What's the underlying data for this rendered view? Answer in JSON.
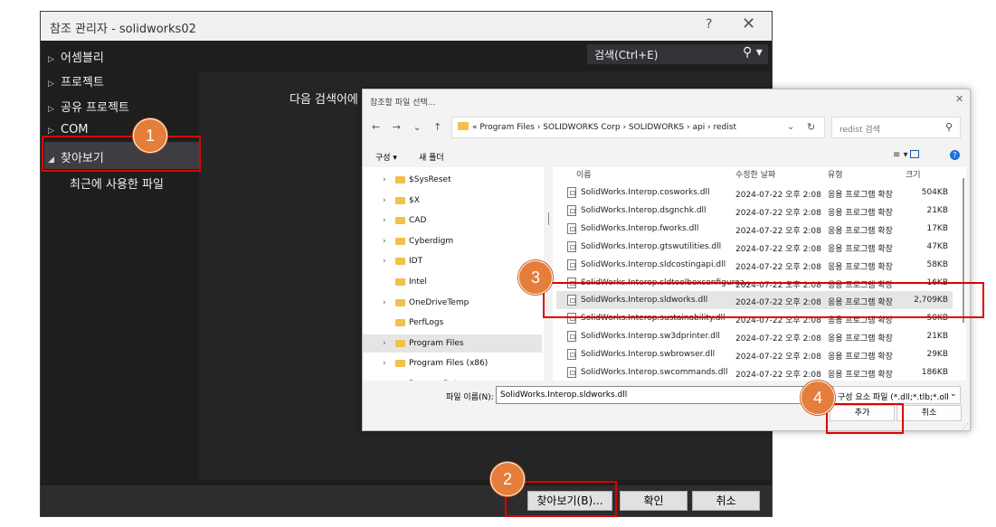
{
  "ref_manager": {
    "title": "참조 관리자 - solidworks02",
    "help_label": "?",
    "close_label": "✕",
    "tree": [
      {
        "label": "어셈블리",
        "arrow": "▷"
      },
      {
        "label": "프로젝트",
        "arrow": "▷"
      },
      {
        "label": "공유 프로젝트",
        "arrow": "▷"
      },
      {
        "label": "COM",
        "arrow": "▷"
      },
      {
        "label": "찾아보기",
        "arrow": "◢"
      }
    ],
    "recent_files": "최근에 사용한 파일",
    "search_placeholder": "검색(Ctrl+E)",
    "search_icon": "⚲ ▾",
    "hint_text": "다음 검색어에 대한",
    "buttons": {
      "browse": "찾아보기(B)...",
      "ok": "확인",
      "cancel": "취소"
    }
  },
  "file_dialog": {
    "title": "참조할 파일 선택...",
    "close_label": "✕",
    "nav": {
      "back": "←",
      "forward": "→",
      "recent": "⌄",
      "up": "↑"
    },
    "address": "« Program Files › SOLIDWORKS Corp › SOLIDWORKS › api › redist",
    "address_chevron": "⌄",
    "refresh_icon": "↻",
    "search_placeholder": "redist 검색",
    "search_icon": "⚲",
    "organize": "구성 ▾",
    "new_folder": "새 폴더",
    "view_icon": "≡ ▾",
    "help_icon": "?",
    "left_tree": [
      {
        "label": "$SysReset",
        "expand": true
      },
      {
        "label": "$X",
        "expand": true
      },
      {
        "label": "CAD",
        "expand": true
      },
      {
        "label": "Cyberdigm",
        "expand": true
      },
      {
        "label": "IDT",
        "expand": true
      },
      {
        "label": "Intel",
        "expand": false
      },
      {
        "label": "OneDriveTemp",
        "expand": true
      },
      {
        "label": "PerfLogs",
        "expand": false
      },
      {
        "label": "Program Files",
        "expand": true,
        "selected": true
      },
      {
        "label": "Program Files (x86)",
        "expand": true
      },
      {
        "label": "ProgramData",
        "expand": true
      }
    ],
    "columns": {
      "name": "이름",
      "date": "수정한 날짜",
      "type": "유형",
      "size": "크기",
      "sort_caret": "^"
    },
    "files": [
      {
        "name": "SolidWorks.Interop.cosworks.dll",
        "date": "2024-07-22 오후 2:08",
        "type": "응용 프로그램 확장",
        "size": "504KB"
      },
      {
        "name": "SolidWorks.Interop.dsgnchk.dll",
        "date": "2024-07-22 오후 2:08",
        "type": "응용 프로그램 확장",
        "size": "21KB"
      },
      {
        "name": "SolidWorks.Interop.fworks.dll",
        "date": "2024-07-22 오후 2:08",
        "type": "응용 프로그램 확장",
        "size": "17KB"
      },
      {
        "name": "SolidWorks.Interop.gtswutilities.dll",
        "date": "2024-07-22 오후 2:08",
        "type": "응용 프로그램 확장",
        "size": "47KB"
      },
      {
        "name": "SolidWorks.Interop.sldcostingapi.dll",
        "date": "2024-07-22 오후 2:08",
        "type": "응용 프로그램 확장",
        "size": "58KB"
      },
      {
        "name": "SolidWorks.Interop.sldtoolboxconfigurea...",
        "date": "2024-07-22 오후 2:08",
        "type": "응용 프로그램 확장",
        "size": "16KB"
      },
      {
        "name": "SolidWorks.Interop.sldworks.dll",
        "date": "2024-07-22 오후 2:08",
        "type": "응용 프로그램 확장",
        "size": "2,709KB",
        "selected": true
      },
      {
        "name": "SolidWorks.Interop.sustainability.dll",
        "date": "2024-07-22 오후 2:08",
        "type": "응용 프로그램 확장",
        "size": "50KB"
      },
      {
        "name": "SolidWorks.Interop.sw3dprinter.dll",
        "date": "2024-07-22 오후 2:08",
        "type": "응용 프로그램 확장",
        "size": "21KB"
      },
      {
        "name": "SolidWorks.Interop.swbrowser.dll",
        "date": "2024-07-22 오후 2:08",
        "type": "응용 프로그램 확장",
        "size": "29KB"
      },
      {
        "name": "SolidWorks.Interop.swcommands.dll",
        "date": "2024-07-22 오후 2:08",
        "type": "응용 프로그램 확장",
        "size": "186KB"
      }
    ],
    "filename_label": "파일 이름(N):",
    "filename_value": "SolidWorks.Interop.sldworks.dll",
    "filter_value": "구성 요소 파일 (*.dll;*.tlb;*.olb;",
    "filter_chevron": "⌄",
    "add_button": "추가",
    "cancel_button": "취소",
    "grip": "⋰"
  },
  "callouts": [
    "1",
    "2",
    "3",
    "4"
  ],
  "colors": {
    "callout_fill": "#e47e3a",
    "highlight_box": "#e00000",
    "dark_bg": "#1e1e1e"
  }
}
